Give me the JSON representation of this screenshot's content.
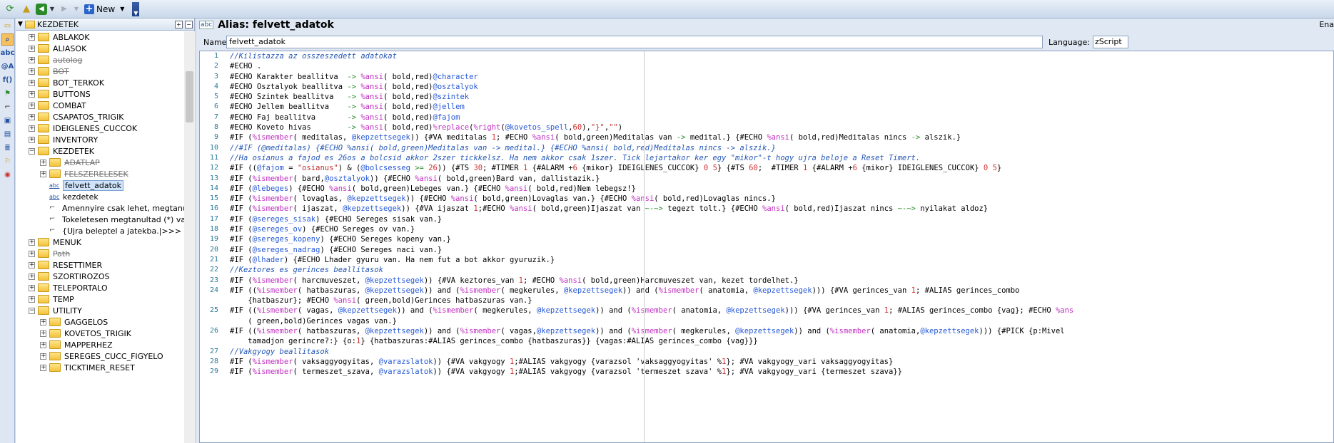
{
  "toolbar": {
    "new_label": "New"
  },
  "tree": {
    "root_label": "KEZDETEK",
    "items": [
      {
        "label": "ABLAKOK",
        "type": "folder",
        "indent": 0,
        "exp": "+",
        "strike": false
      },
      {
        "label": "ALIASOK",
        "type": "folder",
        "indent": 0,
        "exp": "+",
        "strike": false
      },
      {
        "label": "autolog",
        "type": "folder",
        "indent": 0,
        "exp": "+",
        "strike": true
      },
      {
        "label": "BOT",
        "type": "folder",
        "indent": 0,
        "exp": "+",
        "strike": true
      },
      {
        "label": "BOT_TERKOK",
        "type": "folder",
        "indent": 0,
        "exp": "+",
        "strike": false
      },
      {
        "label": "BUTTONS",
        "type": "folder",
        "indent": 0,
        "exp": "+",
        "strike": false
      },
      {
        "label": "COMBAT",
        "type": "folder",
        "indent": 0,
        "exp": "+",
        "strike": false
      },
      {
        "label": "CSAPATOS_TRIGIK",
        "type": "folder",
        "indent": 0,
        "exp": "+",
        "strike": false
      },
      {
        "label": "IDEIGLENES_CUCCOK",
        "type": "folder",
        "indent": 0,
        "exp": "+",
        "strike": false
      },
      {
        "label": "INVENTORY",
        "type": "folder",
        "indent": 0,
        "exp": "+",
        "strike": false
      },
      {
        "label": "KEZDETEK",
        "type": "folder",
        "indent": 0,
        "exp": "−",
        "strike": false
      },
      {
        "label": "ADATLAP",
        "type": "folder",
        "indent": 1,
        "exp": "+",
        "strike": true
      },
      {
        "label": "FELSZERELESEK",
        "type": "folder",
        "indent": 1,
        "exp": "+",
        "strike": true
      },
      {
        "label": "felvett_adatok",
        "type": "alias",
        "indent": 1,
        "exp": "",
        "strike": false,
        "selected": true
      },
      {
        "label": "kezdetek",
        "type": "alias",
        "indent": 1,
        "exp": "",
        "strike": false
      },
      {
        "label": "Amennyire csak lehet, megtanultad (*)",
        "type": "trigger",
        "indent": 1,
        "exp": "",
        "strike": false
      },
      {
        "label": "Tokeletesen megtanultad (*) varazslatot",
        "type": "trigger",
        "indent": 1,
        "exp": "",
        "strike": false
      },
      {
        "label": "{Ujra beleptel a jatekba.|>>> Ekezetek",
        "type": "trigger",
        "indent": 1,
        "exp": "",
        "strike": false
      },
      {
        "label": "MENUK",
        "type": "folder",
        "indent": 0,
        "exp": "+",
        "strike": false
      },
      {
        "label": "Path",
        "type": "folder",
        "indent": 0,
        "exp": "+",
        "strike": true
      },
      {
        "label": "RESETTIMER",
        "type": "folder",
        "indent": 0,
        "exp": "+",
        "strike": false
      },
      {
        "label": "SZORTIROZOS",
        "type": "folder",
        "indent": 0,
        "exp": "+",
        "strike": false
      },
      {
        "label": "TELEPORTALO",
        "type": "folder",
        "indent": 0,
        "exp": "+",
        "strike": false
      },
      {
        "label": "TEMP",
        "type": "folder",
        "indent": 0,
        "exp": "+",
        "strike": false
      },
      {
        "label": "UTILITY",
        "type": "folder",
        "indent": 0,
        "exp": "−",
        "strike": false
      },
      {
        "label": "GAGGELOS",
        "type": "folder",
        "indent": 1,
        "exp": "+",
        "strike": false
      },
      {
        "label": "KOVETOS_TRIGIK",
        "type": "folder",
        "indent": 1,
        "exp": "+",
        "strike": false
      },
      {
        "label": "MAPPERHEZ",
        "type": "folder",
        "indent": 1,
        "exp": "+",
        "strike": false
      },
      {
        "label": "SEREGES_CUCC_FIGYELO",
        "type": "folder",
        "indent": 1,
        "exp": "+",
        "strike": false
      },
      {
        "label": "TICKTIMER_RESET",
        "type": "folder",
        "indent": 1,
        "exp": "+",
        "strike": false
      }
    ]
  },
  "editor": {
    "title": "Alias: felvett_adatok",
    "title_right": "Ena",
    "name_label": "Name:",
    "name_value": "felvett_adatok",
    "language_label": "Language:",
    "language_value": "zScript",
    "lines": [
      {
        "n": "1",
        "text": "//Kilistazza az osszeszedett adatokat"
      },
      {
        "n": "2",
        "text": "#ECHO ."
      },
      {
        "n": "3",
        "text": "#ECHO Karakter beallitva  -> %ansi( bold,red)@character"
      },
      {
        "n": "4",
        "text": "#ECHO Osztalyok beallitva -> %ansi( bold,red)@osztalyok"
      },
      {
        "n": "5",
        "text": "#ECHO Szintek beallitva   -> %ansi( bold,red)@szintek"
      },
      {
        "n": "6",
        "text": "#ECHO Jellem beallitva    -> %ansi( bold,red)@jellem"
      },
      {
        "n": "7",
        "text": "#ECHO Faj beallitva       -> %ansi( bold,red)@fajom"
      },
      {
        "n": "8",
        "text": "#ECHO Koveto hivas        -> %ansi( bold,red)%replace(%right(@kovetos_spell,60),\"}\",\"\")"
      },
      {
        "n": "9",
        "text": "#IF (%ismember( meditalas, @kepzettsegek)) {#VA meditalas 1; #ECHO %ansi( bold,green)Meditalas van -> medital.} {#ECHO %ansi( bold,red)Meditalas nincs -> alszik.}"
      },
      {
        "n": "10",
        "text": "//#IF (@meditalas) {#ECHO %ansi( bold,green)Meditalas van -> medital.} {#ECHO %ansi( bold,red)Meditalas nincs -> alszik.}"
      },
      {
        "n": "11",
        "text": "//Ha osianus a fajod es 26os a bolcsid akkor 2szer tickkelsz. Ha nem akkor csak 1szer. Tick lejartakor ker egy \"mikor\"-t hogy ujra beloje a Reset Timert."
      },
      {
        "n": "12",
        "text": "#IF ((@fajom = \"osianus\") & (@bolcsesseg >= 26)) {#TS 30; #TIMER 1 {#ALARM +6 {mikor} IDEIGLENES_CUCCOK} 0 5} {#TS 60;  #TIMER 1 {#ALARM +6 {mikor} IDEIGLENES_CUCCOK} 0 5}"
      },
      {
        "n": "13",
        "text": "#IF (%ismember( bard,@osztalyok)) {#ECHO %ansi( bold,green)Bard van, dallistazik.}"
      },
      {
        "n": "14",
        "text": "#IF (@lebeges) {#ECHO %ansi( bold,green)Lebeges van.} {#ECHO %ansi( bold,red)Nem lebegsz!}"
      },
      {
        "n": "15",
        "text": "#IF (%ismember( lovaglas, @kepzettsegek)) {#ECHO %ansi( bold,green)Lovaglas van.} {#ECHO %ansi( bold,red)Lovaglas nincs.}"
      },
      {
        "n": "16",
        "text": "#IF (%ismember( ijaszat, @kepzettsegek)) {#VA ijaszat 1;#ECHO %ansi( bold,green)Ijaszat van ~-~> tegezt tolt.} {#ECHO %ansi( bold,red)Ijaszat nincs ~-~> nyilakat aldoz}"
      },
      {
        "n": "17",
        "text": "#IF (@sereges_sisak) {#ECHO Sereges sisak van.}"
      },
      {
        "n": "18",
        "text": "#IF (@sereges_ov) {#ECHO Sereges ov van.}"
      },
      {
        "n": "19",
        "text": "#IF (@sereges_kopeny) {#ECHO Sereges kopeny van.}"
      },
      {
        "n": "20",
        "text": "#IF (@sereges_nadrag) {#ECHO Sereges naci van.}"
      },
      {
        "n": "21",
        "text": "#IF (@lhader) {#ECHO Lhader gyuru van. Ha nem fut a bot akkor gyuruzik.}"
      },
      {
        "n": "22",
        "text": "//Keztores es gerinces beallitasok"
      },
      {
        "n": "23",
        "text": "#IF (%ismember( harcmuveszet, @kepzettsegek)) {#VA keztores_van 1; #ECHO %ansi( bold,green)Harcmuveszet van, kezet tordelhet.}"
      },
      {
        "n": "24",
        "text": "#IF ((%ismember( hatbaszuras, @kepzettsegek)) and (%ismember( megkerules, @kepzettsegek)) and (%ismember( anatomia, @kepzettsegek))) {#VA gerinces_van 1; #ALIAS gerinces_combo"
      },
      {
        "n": "",
        "text": "    {hatbaszur}; #ECHO %ansi( green,bold)Gerinces hatbaszuras van.}"
      },
      {
        "n": "25",
        "text": "#IF ((%ismember( vagas, @kepzettsegek)) and (%ismember( megkerules, @kepzettsegek)) and (%ismember( anatomia, @kepzettsegek))) {#VA gerinces_van 1; #ALIAS gerinces_combo {vag}; #ECHO %ans"
      },
      {
        "n": "",
        "text": "    ( green,bold)Gerinces vagas van.}"
      },
      {
        "n": "26",
        "text": "#IF ((%ismember( hatbaszuras, @kepzettsegek)) and (%ismember( vagas,@kepzettsegek)) and (%ismember( megkerules, @kepzettsegek)) and (%ismember( anatomia,@kepzettsegek))) {#PICK {p:Mivel"
      },
      {
        "n": "",
        "text": "    tamadjon gerincre?:} {o:1} {hatbaszuras:#ALIAS gerinces_combo {hatbaszuras}} {vagas:#ALIAS gerinces_combo {vag}}}"
      },
      {
        "n": "27",
        "text": "//Vakgyogy beallitasok"
      },
      {
        "n": "28",
        "text": "#IF (%ismember( vaksaggyogyitas, @varazslatok)) {#VA vakgyogy 1;#ALIAS vakgyogy {varazsol 'vaksaggyogyitas' %1}; #VA vakgyogy_vari vaksaggyogyitas}"
      },
      {
        "n": "29",
        "text": "#IF (%ismember( termeszet_szava, @varazslatok)) {#VA vakgyogy 1;#ALIAS vakgyogy {varazsol 'termeszet szava' %1}; #VA vakgyogy_vari {termeszet szava}}"
      }
    ]
  }
}
